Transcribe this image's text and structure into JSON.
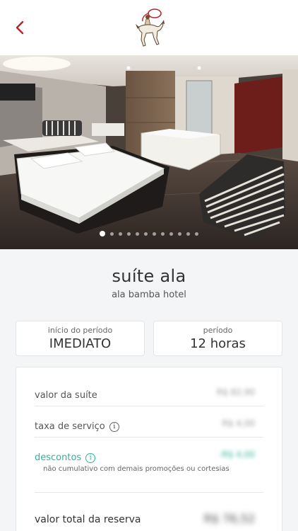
{
  "header": {
    "back_icon": "chevron-left-icon",
    "logo_icon": "cowboy-horse-logo",
    "accent_color": "#b8232b"
  },
  "gallery": {
    "slides": 12,
    "active_index": 0
  },
  "room": {
    "title": "suíte ala",
    "hotel": "ala bamba hotel"
  },
  "period": {
    "start_label": "início do período",
    "start_value": "IMEDIATO",
    "duration_label": "período",
    "duration_value": "12 horas"
  },
  "pricing": {
    "room_label": "valor da suíte",
    "room_value": "R$ 82,90",
    "service_label": "taxa de serviço",
    "service_value": "R$ 4,00",
    "discount_label": "descontos",
    "discount_value": "-R$ 4,00",
    "discount_note": "não cumulativo com demais promoções ou cortesias",
    "total_label": "valor total da reserva",
    "total_value": "R$ 76,52",
    "discount_color": "#2fb39a"
  }
}
